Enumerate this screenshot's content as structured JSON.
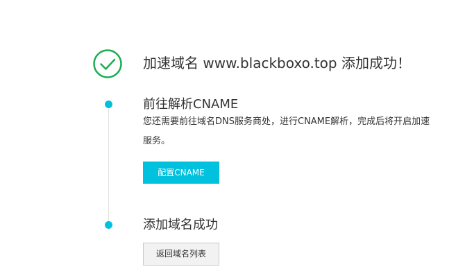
{
  "result": {
    "icon": "check-circle-icon",
    "success_color": "#1aad52",
    "title": "加速域名 www.blackboxo.top 添加成功！"
  },
  "steps": [
    {
      "title": "前往解析CNAME",
      "description": "您还需要前往域名DNS服务商处，进行CNAME解析，完成后将开启加速服务。",
      "button_label": "配置CNAME"
    },
    {
      "title": "添加域名成功",
      "button_label": "返回域名列表"
    }
  ],
  "colors": {
    "accent": "#00c1de",
    "timeline": "#e2e2e2",
    "text": "#333333"
  }
}
